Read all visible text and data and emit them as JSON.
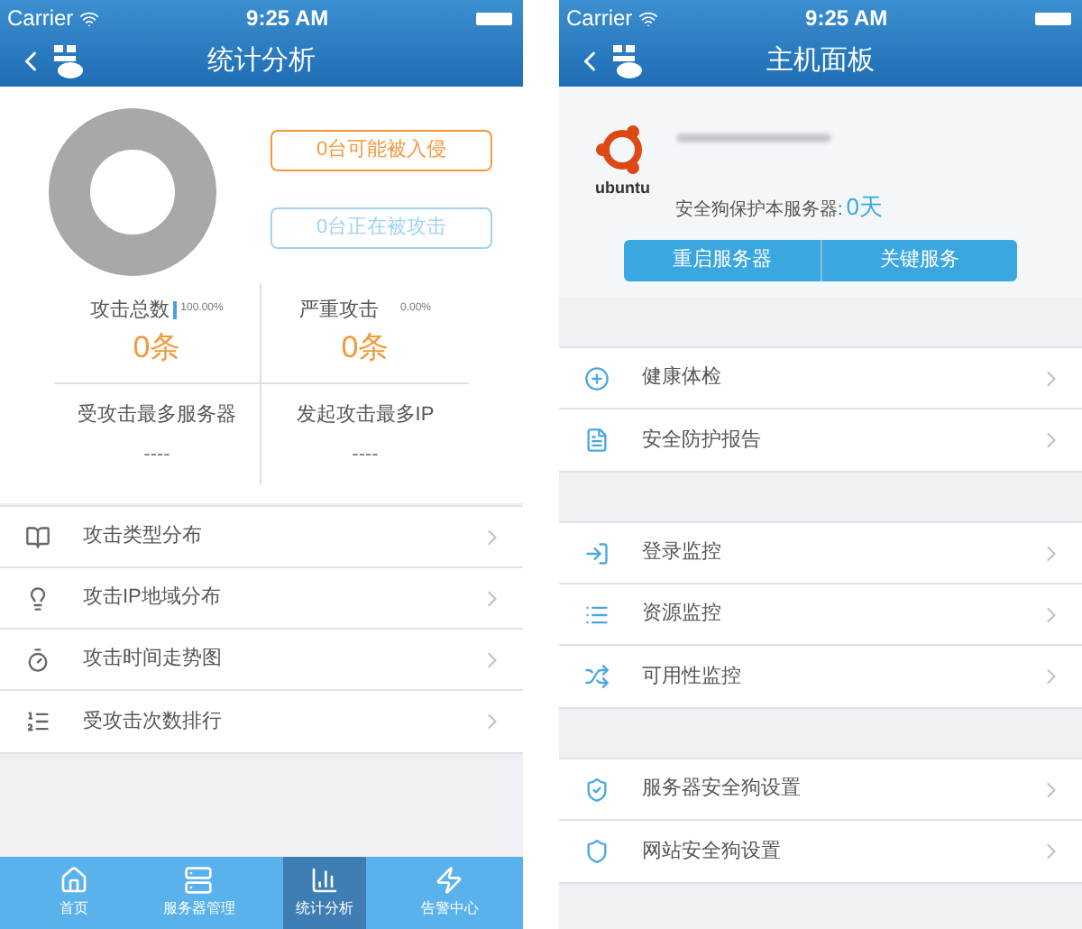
{
  "left": {
    "status_bar": {
      "carrier": "Carrier",
      "time": "9:25 AM"
    },
    "nav_bar": {
      "title": "统计分析"
    },
    "alerts": [
      {
        "text": "0台可能被入侵",
        "color": "#f39a3c"
      },
      {
        "text": "0台正在被攻击",
        "color": "#9fd3f3"
      }
    ],
    "stats": [
      {
        "kind": "count",
        "label": "攻击总数",
        "trend_down": true,
        "percent": "100.00%",
        "value": "0条"
      },
      {
        "kind": "count",
        "label": "严重攻击",
        "trend_down": false,
        "percent": "0.00%",
        "value": "0条"
      },
      {
        "kind": "top",
        "label": "受攻击最多服务器",
        "value": "----"
      },
      {
        "kind": "top",
        "label": "发起攻击最多IP",
        "value": "----"
      }
    ],
    "menu": [
      {
        "label": "攻击类型分布"
      },
      {
        "label": "攻击IP地域分布"
      },
      {
        "label": "攻击时间走势图"
      },
      {
        "label": "受攻击次数排行"
      }
    ],
    "tab_bar": [
      {
        "label": "首页",
        "selected": false
      },
      {
        "label": "服务器管理",
        "selected": false
      },
      {
        "label": "统计分析",
        "selected": true
      },
      {
        "label": "告警中心",
        "selected": false
      }
    ]
  },
  "right": {
    "status_bar": {
      "carrier": "Carrier",
      "time": "9:25 AM"
    },
    "nav_bar": {
      "title": "主机面板"
    },
    "server": {
      "logo_text": "ubuntu",
      "protect_label": "安全狗保护本服务器:",
      "protect_days": "0天"
    },
    "actions": [
      "重启服务器",
      "关键服务"
    ],
    "groups": [
      [
        {
          "label": "健康体检"
        },
        {
          "label": "安全防护报告"
        }
      ],
      [
        {
          "label": "登录监控"
        },
        {
          "label": "资源监控"
        },
        {
          "label": "可用性监控"
        }
      ],
      [
        {
          "label": "服务器安全狗设置"
        },
        {
          "label": "网站安全狗设置"
        }
      ]
    ]
  }
}
